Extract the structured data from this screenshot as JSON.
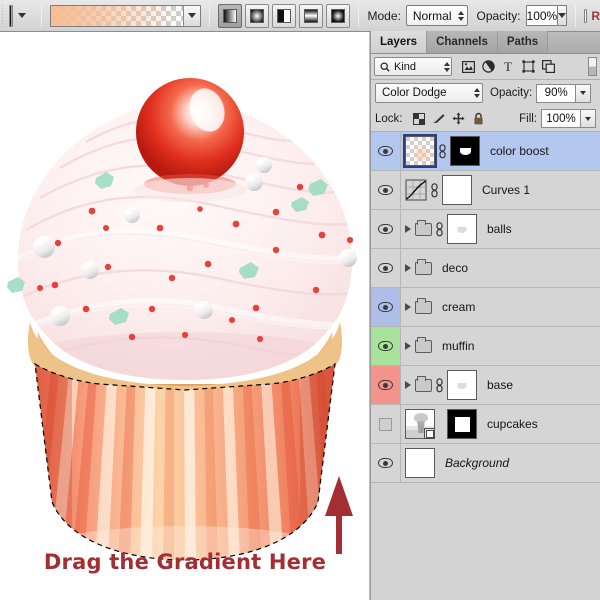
{
  "options_bar": {
    "tool_preset_name": "gradient-preset",
    "gradient_swatch_name": "foreground-to-transparent",
    "gradient_types": [
      {
        "name": "linear-gradient",
        "label": "Linear",
        "active": true
      },
      {
        "name": "radial-gradient",
        "label": "Radial",
        "active": false
      },
      {
        "name": "angle-gradient",
        "label": "Angle",
        "active": false
      },
      {
        "name": "reflected-gradient",
        "label": "Reflected",
        "active": false
      },
      {
        "name": "diamond-gradient",
        "label": "Diamond",
        "active": false
      }
    ],
    "mode_label": "Mode:",
    "mode_value": "Normal",
    "opacity_label": "Opacity:",
    "opacity_value": "100%",
    "reverse_label": "R",
    "accent_color": "#f7bc94"
  },
  "canvas": {
    "instruction_text": "Drag the Gradient Here",
    "instruction_color": "#a32f34",
    "arrow_name": "direction-arrow-up",
    "arrow_color": "#a32f34",
    "selection_name": "marching-ants-selection",
    "artwork_name": "cupcake-illustration"
  },
  "panel": {
    "tabs": [
      {
        "label": "Layers",
        "active": true
      },
      {
        "label": "Channels",
        "active": false
      },
      {
        "label": "Paths",
        "active": false
      }
    ],
    "filter": {
      "kind_label": "Kind",
      "search_icon": "search-icon",
      "icons": [
        {
          "name": "filter-pixel-icon",
          "glyph": "▣"
        },
        {
          "name": "filter-adjustment-icon",
          "glyph": "◑"
        },
        {
          "name": "filter-type-icon",
          "glyph": "T"
        },
        {
          "name": "filter-shape-icon",
          "glyph": "⬚"
        },
        {
          "name": "filter-smart-object-icon",
          "glyph": "❐"
        }
      ]
    },
    "blend": {
      "mode_value": "Color Dodge",
      "opacity_label": "Opacity:",
      "opacity_value": "90%"
    },
    "lock": {
      "label": "Lock:",
      "icons": [
        {
          "name": "lock-transparency-icon",
          "glyph": "▦"
        },
        {
          "name": "lock-image-icon",
          "glyph": "✒"
        },
        {
          "name": "lock-position-icon",
          "glyph": "✥"
        },
        {
          "name": "lock-all-icon",
          "glyph": "🔒"
        }
      ],
      "fill_label": "Fill:",
      "fill_value": "100%"
    },
    "layers": [
      {
        "name": "color boost",
        "visible": true,
        "selected": true,
        "color_tag": "none",
        "type": "pixel",
        "has_disclosure": false,
        "has_link": true,
        "thumb": "checker",
        "mask": "black-blob",
        "italic": false
      },
      {
        "name": "Curves 1",
        "visible": true,
        "selected": false,
        "color_tag": "none",
        "type": "adjustment",
        "has_disclosure": false,
        "has_link": true,
        "thumb": "curves",
        "mask": "white",
        "italic": false
      },
      {
        "name": "balls",
        "visible": true,
        "selected": false,
        "color_tag": "none",
        "type": "group",
        "has_disclosure": true,
        "has_link": true,
        "thumb": "none",
        "mask": "white-faint",
        "italic": false
      },
      {
        "name": "deco",
        "visible": true,
        "selected": false,
        "color_tag": "none",
        "type": "group",
        "has_disclosure": true,
        "has_link": false,
        "thumb": "none",
        "mask": "none",
        "italic": false
      },
      {
        "name": "cream",
        "visible": true,
        "selected": false,
        "color_tag": "#aebee8",
        "type": "group",
        "has_disclosure": true,
        "has_link": false,
        "thumb": "none",
        "mask": "none",
        "italic": false
      },
      {
        "name": "muffin",
        "visible": true,
        "selected": false,
        "color_tag": "#a7e39a",
        "type": "group",
        "has_disclosure": true,
        "has_link": false,
        "thumb": "none",
        "mask": "none",
        "italic": false
      },
      {
        "name": "base",
        "visible": true,
        "selected": false,
        "color_tag": "#f4928c",
        "type": "group",
        "has_disclosure": true,
        "has_link": true,
        "thumb": "none",
        "mask": "white-faint",
        "italic": false
      },
      {
        "name": "cupcakes",
        "visible": false,
        "selected": false,
        "color_tag": "none",
        "type": "smart-object",
        "has_disclosure": false,
        "has_link": false,
        "thumb": "smart",
        "mask": "black-square",
        "italic": false
      },
      {
        "name": "Background",
        "visible": true,
        "selected": false,
        "color_tag": "none",
        "type": "background",
        "has_disclosure": false,
        "has_link": false,
        "thumb": "white",
        "mask": "none",
        "italic": true
      }
    ]
  }
}
